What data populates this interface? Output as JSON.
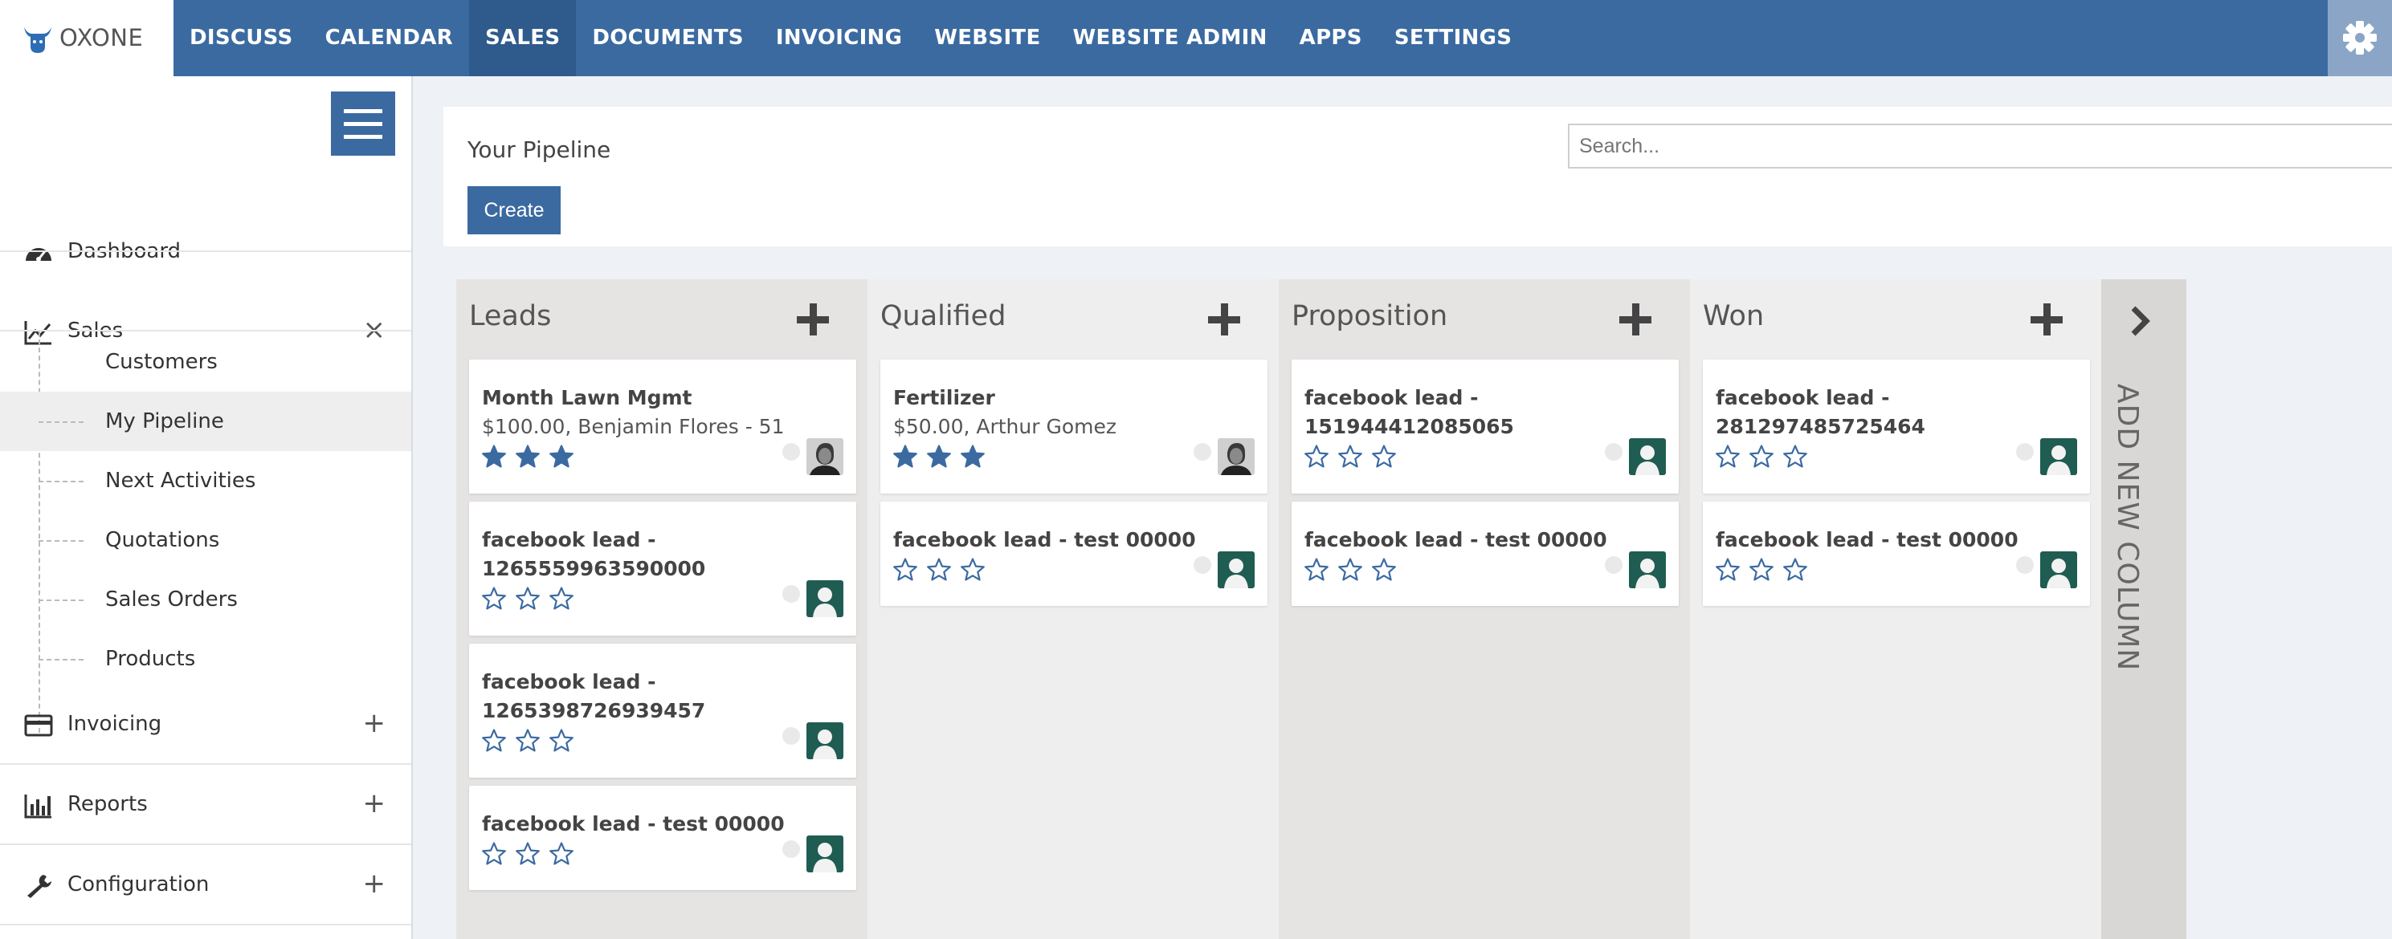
{
  "brand": {
    "name": "OXONE"
  },
  "topnav": {
    "items": [
      {
        "label": "DISCUSS"
      },
      {
        "label": "CALENDAR"
      },
      {
        "label": "SALES",
        "active": true
      },
      {
        "label": "DOCUMENTS"
      },
      {
        "label": "INVOICING"
      },
      {
        "label": "WEBSITE"
      },
      {
        "label": "WEBSITE ADMIN"
      },
      {
        "label": "APPS"
      },
      {
        "label": "SETTINGS"
      }
    ],
    "settings_icon": "gear-icon"
  },
  "sidebar": {
    "items": [
      {
        "label": "Dashboard",
        "icon": "dashboard-icon"
      },
      {
        "label": "Sales",
        "icon": "chart-line-icon",
        "action": "×",
        "children": [
          {
            "label": "Customers"
          },
          {
            "label": "My Pipeline",
            "active": true
          },
          {
            "label": "Next Activities"
          },
          {
            "label": "Quotations"
          },
          {
            "label": "Sales Orders"
          },
          {
            "label": "Products"
          }
        ]
      },
      {
        "label": "Invoicing",
        "icon": "credit-card-icon",
        "action": "+"
      },
      {
        "label": "Reports",
        "icon": "bar-chart-icon",
        "action": "+"
      },
      {
        "label": "Configuration",
        "icon": "wrench-icon",
        "action": "+"
      }
    ]
  },
  "header": {
    "title": "Your Pipeline",
    "create_label": "Create",
    "search_placeholder": "Search..."
  },
  "columns": [
    {
      "title": "Leads",
      "cards": [
        {
          "title": "Month Lawn Mgmt",
          "subtitle": "$100.00, Benjamin Flores - 51",
          "stars": 3,
          "avatar": "photo"
        },
        {
          "title": "facebook lead - 1265559963590000",
          "subtitle": "",
          "stars": 0,
          "avatar": "default"
        },
        {
          "title": "facebook lead - 1265398726939457",
          "subtitle": "",
          "stars": 0,
          "avatar": "default"
        },
        {
          "title": "facebook lead - test 00000",
          "subtitle": "",
          "stars": 0,
          "avatar": "default"
        }
      ]
    },
    {
      "title": "Qualified",
      "cards": [
        {
          "title": "Fertilizer",
          "subtitle": "$50.00, Arthur Gomez",
          "stars": 3,
          "avatar": "photo"
        },
        {
          "title": "facebook lead - test 00000",
          "subtitle": "",
          "stars": 0,
          "avatar": "default"
        }
      ]
    },
    {
      "title": "Proposition",
      "cards": [
        {
          "title": "facebook lead - 151944412085065",
          "subtitle": "",
          "stars": 0,
          "avatar": "default"
        },
        {
          "title": "facebook lead - test 00000",
          "subtitle": "",
          "stars": 0,
          "avatar": "default"
        }
      ]
    },
    {
      "title": "Won",
      "cards": [
        {
          "title": "facebook lead - 281297485725464",
          "subtitle": "",
          "stars": 0,
          "avatar": "default"
        },
        {
          "title": "facebook lead - test 00000",
          "subtitle": "",
          "stars": 0,
          "avatar": "default"
        }
      ]
    }
  ],
  "add_column": {
    "label": "ADD NEW COLUMN"
  },
  "colors": {
    "primary": "#3b6aa1",
    "star": "#3b6aa1",
    "avatar_bg": "#1f5c52"
  }
}
